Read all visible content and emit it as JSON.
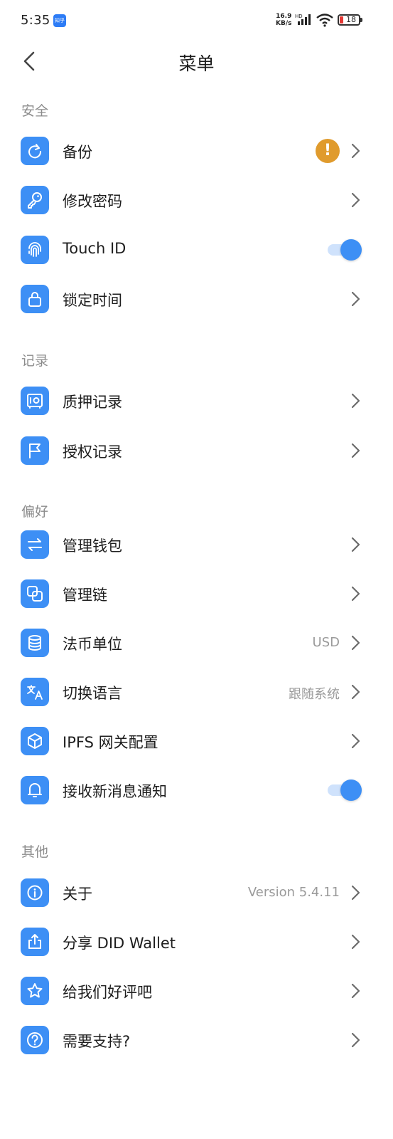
{
  "status_bar": {
    "time": "5:35",
    "app_badge": "知乎",
    "speed_value": "16.9",
    "speed_unit": "KB/s",
    "battery": "18"
  },
  "header": {
    "title": "菜单"
  },
  "sections": {
    "security": {
      "title": "安全",
      "backup": {
        "label": "备份",
        "badge": "!"
      },
      "change_password": {
        "label": "修改密码"
      },
      "touch_id": {
        "label": "Touch ID",
        "enabled": true
      },
      "lock_time": {
        "label": "锁定时间"
      }
    },
    "records": {
      "title": "记录",
      "pledge_records": {
        "label": "质押记录"
      },
      "authorization_records": {
        "label": "授权记录"
      }
    },
    "preferences": {
      "title": "偏好",
      "manage_wallet": {
        "label": "管理钱包"
      },
      "manage_chain": {
        "label": "管理链"
      },
      "fiat_unit": {
        "label": "法币单位",
        "value": "USD"
      },
      "switch_language": {
        "label": "切换语言",
        "value": "跟随系统"
      },
      "ipfs_gateway": {
        "label": "IPFS 网关配置"
      },
      "notifications": {
        "label": "接收新消息通知",
        "enabled": true
      }
    },
    "other": {
      "title": "其他",
      "about": {
        "label": "关于",
        "value": "Version 5.4.11"
      },
      "share": {
        "label": "分享 DID Wallet"
      },
      "rate": {
        "label": "给我们好评吧"
      },
      "support": {
        "label": "需要支持?"
      }
    }
  },
  "colors": {
    "accent": "#3d8ff5",
    "warning_badge": "#e09b2d",
    "section_header": "#8c8c8c",
    "value_text": "#9a9a9a"
  },
  "icons": {
    "back": "chevron-left-icon",
    "backup": "refresh-icon",
    "change_password": "key-icon",
    "touch_id": "fingerprint-icon",
    "lock_time": "lock-icon",
    "pledge_records": "safe-icon",
    "authorization_records": "flag-icon",
    "manage_wallet": "swap-arrows-icon",
    "manage_chain": "chain-link-icon",
    "fiat_unit": "database-icon",
    "switch_language": "translate-icon",
    "ipfs_gateway": "cube-icon",
    "notifications": "bell-icon",
    "about": "info-icon",
    "share": "share-icon",
    "rate": "star-icon",
    "support": "help-icon"
  }
}
